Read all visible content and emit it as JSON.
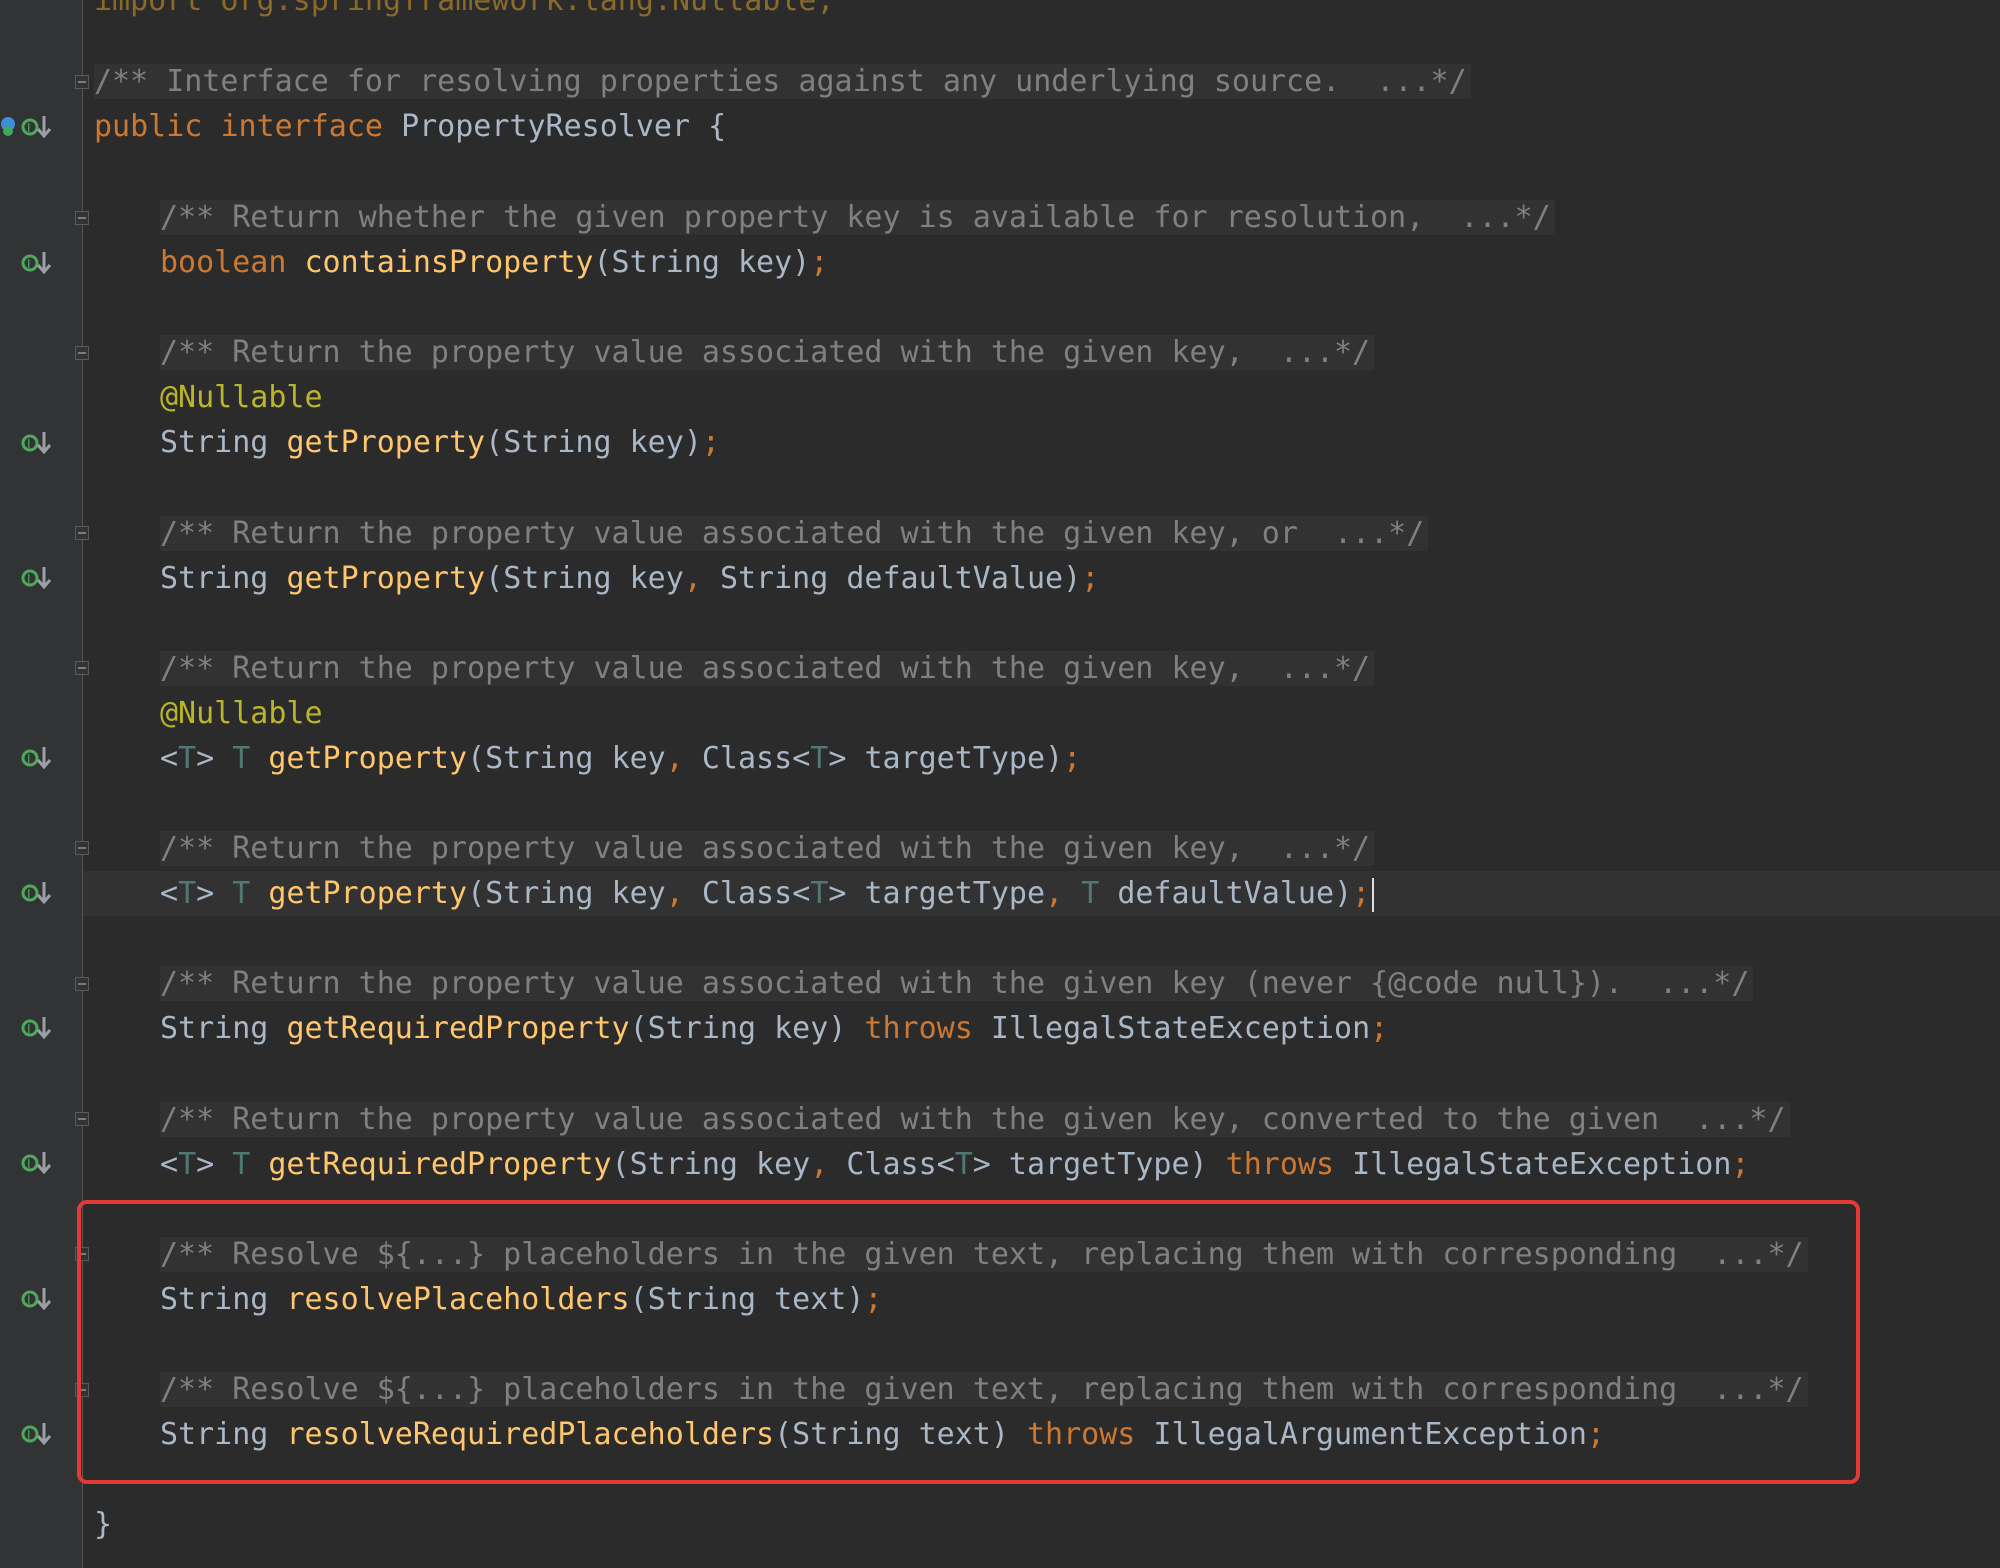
{
  "editor": {
    "import_line": "import org.springframework.lang.Nullable;",
    "interface_doc": "/** Interface for resolving properties against any underlying source.  ...*/",
    "interface_decl": {
      "kw_public": "public",
      "kw_interface": "interface",
      "name": "PropertyResolver",
      "open_brace": " {"
    },
    "doc_contains_property": "/** Return whether the given property key is available for resolution,  ...*/",
    "doc_get_property_1": "/** Return the property value associated with the given key,  ...*/",
    "doc_get_property_2": "/** Return the property value associated with the given key, or  ...*/",
    "doc_get_property_3": "/** Return the property value associated with the given key,  ...*/",
    "doc_get_property_4": "/** Return the property value associated with the given key,  ...*/",
    "doc_get_required_1": "/** Return the property value associated with the given key (never {@code null}).  ...*/",
    "doc_get_required_2": "/** Return the property value associated with the given key, converted to the given  ...*/",
    "doc_resolve_placeholders": "/** Resolve ${...} placeholders in the given text, replacing them with corresponding  ...*/",
    "doc_resolve_required": "/** Resolve ${...} placeholders in the given text, replacing them with corresponding  ...*/",
    "annotation_nullable": "@Nullable",
    "closing_brace": "}",
    "tokens": {
      "boolean": "boolean",
      "string": "String",
      "generic_t": "<T>",
      "t": "T",
      "class": "Class",
      "lt": "<",
      "gt": ">",
      "throws": "throws",
      "illegal_state": "IllegalStateException",
      "illegal_argument": "IllegalArgumentException",
      "contains_property": "containsProperty",
      "get_property": "getProperty",
      "get_required_property": "getRequiredProperty",
      "resolve_placeholders": "resolvePlaceholders",
      "resolve_required_placeholders": "resolveRequiredPlaceholders",
      "open_paren": "(",
      "close_paren": ")",
      "comma": ",",
      "semicolon": ";",
      "param_key": "key",
      "param_text": "text",
      "param_default_value": "defaultValue",
      "param_target_type": "targetType"
    }
  },
  "colors": {
    "background": "#2b2b2b",
    "comment": "#808080",
    "keyword": "#cc7832",
    "method": "#ffc66d",
    "annotation": "#bbb529",
    "highlight_box": "#e53935"
  },
  "icons": {
    "gutter_implemented": "implemented-method-icon",
    "gutter_bookmark": "bookmark-icon",
    "fold": "fold-marker-icon"
  }
}
